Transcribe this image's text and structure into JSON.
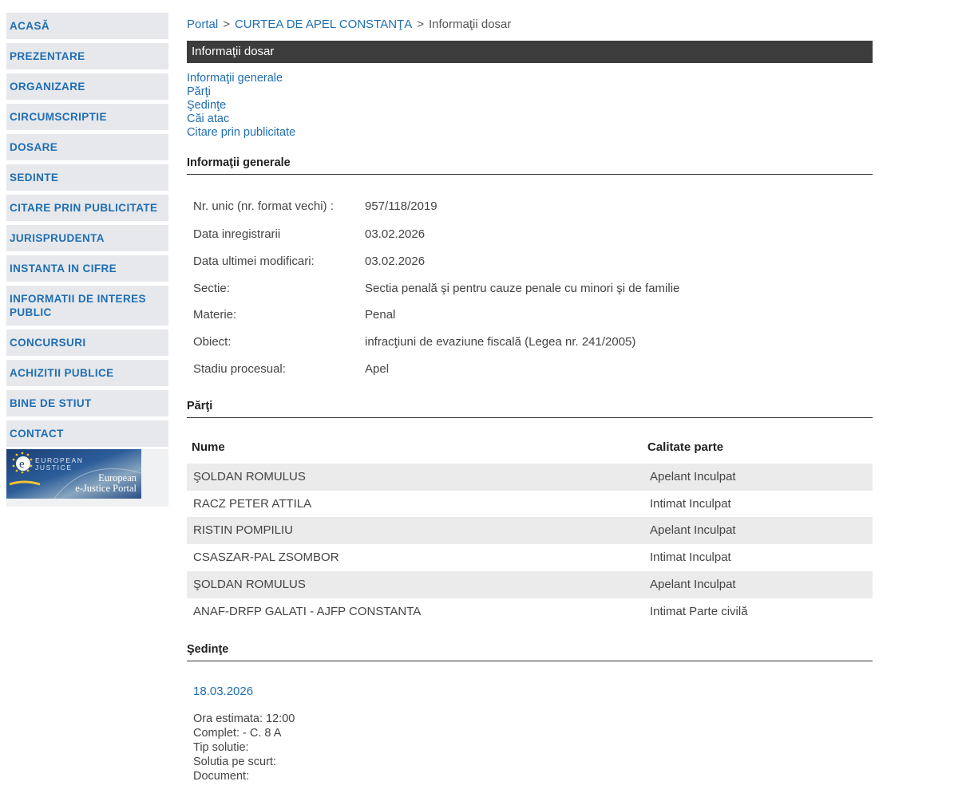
{
  "sidebar": {
    "items": [
      {
        "label": "ACASĂ"
      },
      {
        "label": "PREZENTARE"
      },
      {
        "label": "ORGANIZARE"
      },
      {
        "label": "CIRCUMSCRIPTIE"
      },
      {
        "label": "DOSARE"
      },
      {
        "label": "SEDINTE"
      },
      {
        "label": "CITARE PRIN PUBLICITATE"
      },
      {
        "label": "JURISPRUDENTA"
      },
      {
        "label": "INSTANTA IN CIFRE"
      },
      {
        "label": "INFORMATII DE INTERES PUBLIC"
      },
      {
        "label": "CONCURSURI"
      },
      {
        "label": "ACHIZITII PUBLICE"
      },
      {
        "label": "BINE DE STIUT"
      },
      {
        "label": "CONTACT"
      }
    ],
    "ejustice_banner": {
      "top_line1": "EUROPEAN",
      "top_line2": "JUSTICE",
      "bottom_line1": "European",
      "bottom_line2": "e-Justice Portal"
    }
  },
  "breadcrumb": {
    "portal": "Portal",
    "separator": ">",
    "court": "CURTEA DE APEL CONSTANŢA",
    "current": "Informaţii dosar"
  },
  "title_bar": "Informaţii dosar",
  "quick_links": [
    "Informaţii generale",
    "Părţi",
    "Şedinţe",
    "Căi atac",
    "Citare prin publicitate"
  ],
  "general": {
    "heading": "Informaţii generale",
    "rows": [
      {
        "label": "Nr. unic (nr. format vechi) :",
        "value": "957/118/2019"
      },
      {
        "label": "Data inregistrarii",
        "value": "03.02.2026"
      },
      {
        "label": "Data ultimei modificari:",
        "value": "03.02.2026"
      },
      {
        "label": "Sectie:",
        "value": "Sectia penală şi pentru cauze penale cu minori şi de familie"
      },
      {
        "label": "Materie:",
        "value": "Penal"
      },
      {
        "label": "Obiect:",
        "value": "infracţiuni de evaziune fiscală (Legea nr. 241/2005)"
      },
      {
        "label": "Stadiu procesual:",
        "value": "Apel"
      }
    ]
  },
  "parties": {
    "heading": "Părţi",
    "col_name": "Nume",
    "col_role": "Calitate parte",
    "rows": [
      {
        "name": "ŞOLDAN ROMULUS",
        "role": "Apelant Inculpat"
      },
      {
        "name": "RACZ PETER ATTILA",
        "role": "Intimat Inculpat"
      },
      {
        "name": "RISTIN POMPILIU",
        "role": "Apelant Inculpat"
      },
      {
        "name": "CSASZAR-PAL ZSOMBOR",
        "role": "Intimat Inculpat"
      },
      {
        "name": "ŞOLDAN ROMULUS",
        "role": "Apelant Inculpat"
      },
      {
        "name": "ANAF-DRFP GALATI - AJFP CONSTANTA",
        "role": "Intimat Parte civilă"
      }
    ]
  },
  "hearings": {
    "heading": "Şedinţe",
    "date": "18.03.2026",
    "details": [
      "Ora estimata: 12:00",
      "Complet: - C. 8 A",
      "Tip solutie:",
      "Solutia pe scurt:",
      "Document:"
    ]
  },
  "colors": {
    "link": "#1f6eb3",
    "nav_bg": "#e6e8ec",
    "title_bar_bg": "#3c3c3c",
    "row_shade": "#ebebeb"
  }
}
